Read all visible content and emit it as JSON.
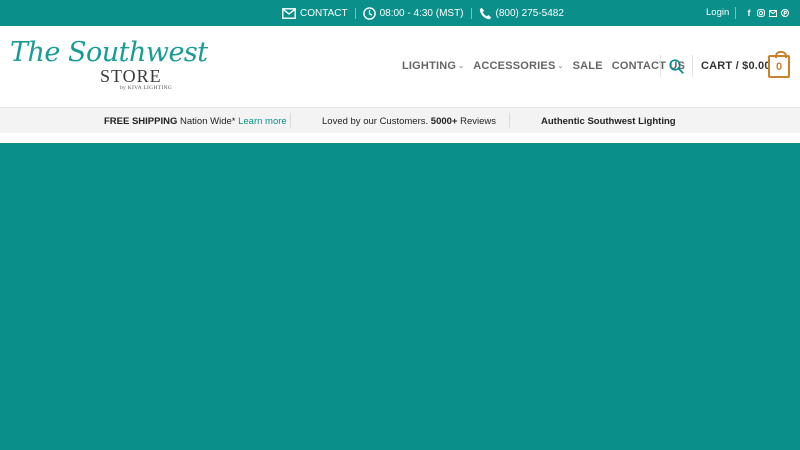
{
  "topbar": {
    "contact_label": "CONTACT",
    "hours": "08:00 - 4:30 (MST)",
    "phone": "(800) 275-5482",
    "login_label": "Login",
    "social_icons": [
      "facebook-icon",
      "instagram-icon",
      "email-icon",
      "pinterest-icon"
    ]
  },
  "logo": {
    "script": "The Southwest",
    "store": "STORE",
    "byline": "by KIVA LIGHTING"
  },
  "nav": {
    "items": [
      {
        "label": "LIGHTING",
        "has_dropdown": true
      },
      {
        "label": "ACCESSORIES",
        "has_dropdown": true
      },
      {
        "label": "SALE",
        "has_dropdown": false
      },
      {
        "label": "CONTACT US",
        "has_dropdown": false
      }
    ]
  },
  "cart": {
    "label": "CART /",
    "total": "$0.00",
    "count": "0"
  },
  "promo": {
    "shipping_bold": "FREE SHIPPING",
    "shipping_text": "Nation Wide*",
    "shipping_link": "Learn more",
    "reviews_pre": "Loved by our Customers.",
    "reviews_bold": "5000+",
    "reviews_post": "Reviews",
    "authentic": "Authentic Southwest Lighting"
  },
  "colors": {
    "teal": "#0a8f8a",
    "accent": "#c9822a",
    "promo_bg": "#f3f3f3"
  }
}
